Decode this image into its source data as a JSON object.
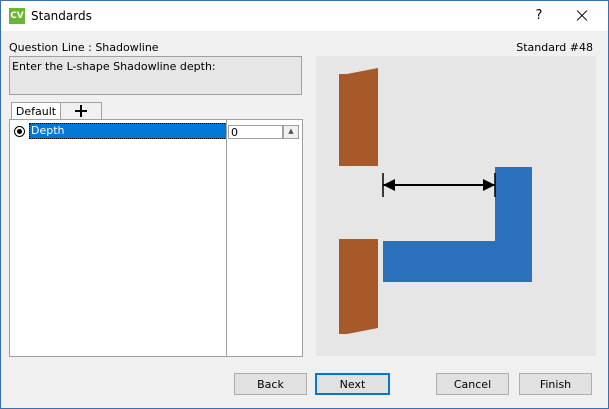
{
  "window": {
    "title": "Standards",
    "icon_text": "CV",
    "help_label": "?"
  },
  "question_line": "Question Line : Shadowline",
  "standard_number": "Standard #48",
  "prompt": "Enter the L-shape Shadowline depth:",
  "tabs": [
    {
      "label": "Default"
    }
  ],
  "grid": {
    "rows": [
      {
        "label": "Depth",
        "value": "0"
      }
    ]
  },
  "preview_colors": {
    "wood": "#a65a2a",
    "profile": "#2a70ba"
  },
  "buttons": {
    "back": "Back",
    "next": "Next",
    "cancel": "Cancel",
    "finish": "Finish"
  }
}
